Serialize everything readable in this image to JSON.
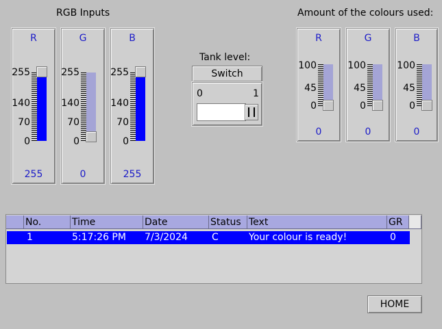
{
  "rgb_inputs": {
    "title": "RGB Inputs",
    "ticks": [
      "255",
      "140",
      "70",
      "0"
    ],
    "sliders": [
      {
        "letter": "R",
        "value": "255",
        "level": 1.0
      },
      {
        "letter": "G",
        "value": "0",
        "level": 0.0
      },
      {
        "letter": "B",
        "value": "255",
        "level": 1.0
      }
    ]
  },
  "tank": {
    "title": "Tank level:",
    "switch_label": "Switch",
    "min": "0",
    "max": "1",
    "input_value": ""
  },
  "amount": {
    "title": "Amount of the colours used:",
    "ticks": [
      "100",
      "45",
      "0"
    ],
    "sliders": [
      {
        "letter": "R",
        "value": "0",
        "level": 0.0
      },
      {
        "letter": "G",
        "value": "0",
        "level": 0.0
      },
      {
        "letter": "B",
        "value": "0",
        "level": 0.0
      }
    ]
  },
  "table": {
    "headers": [
      "No.",
      "Time",
      "Date",
      "Status",
      "Text",
      "GR"
    ],
    "rows": [
      {
        "no": "1",
        "time": "5:17:26 PM",
        "date": "7/3/2024",
        "status": "C",
        "text": "Your colour is ready!",
        "gr": "0"
      }
    ]
  },
  "home_label": "HOME",
  "colors": {
    "accent": "#0000ff",
    "label_blue": "#1a1ac8",
    "track": "#a4a4d6"
  }
}
